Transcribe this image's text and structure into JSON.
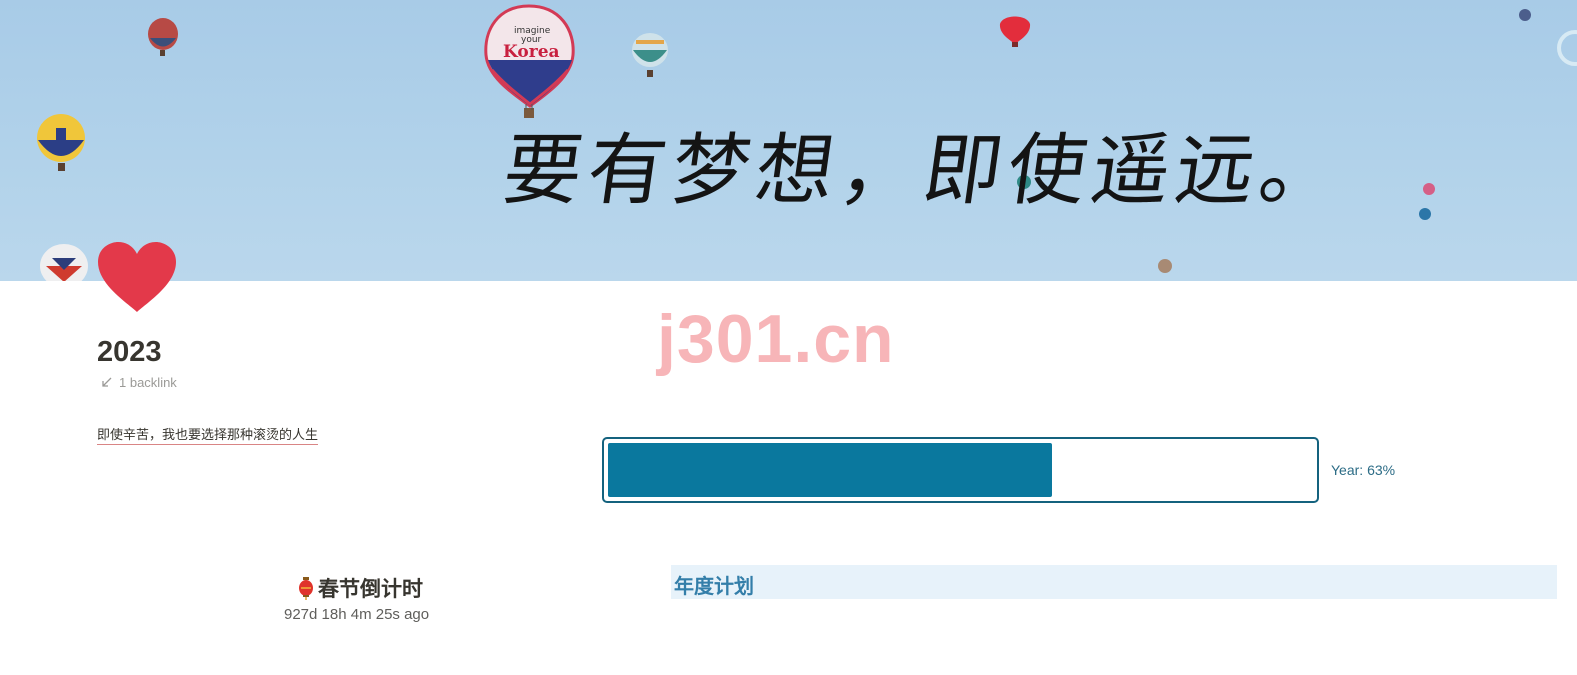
{
  "cover": {
    "slogan": "要有梦想，即使遥远。",
    "balloon_text_line1": "imagine",
    "balloon_text_line2": "your",
    "balloon_text_line3": "Korea",
    "sky_color": "#afd0e9"
  },
  "page": {
    "icon": "heart-icon",
    "title": "2023",
    "backlink_label": "1 backlink",
    "quote": "即使辛苦，我也要选择那种滚烫的人生"
  },
  "watermark": "j301.cn",
  "progress": {
    "label": "Year: 63%",
    "fraction": 0.63,
    "fill_color": "#0a789e"
  },
  "countdown": {
    "icon": "lantern-icon",
    "title": "春节倒计时",
    "value": "927d 18h 4m 25s ago"
  },
  "plan": {
    "heading": "年度计划"
  }
}
